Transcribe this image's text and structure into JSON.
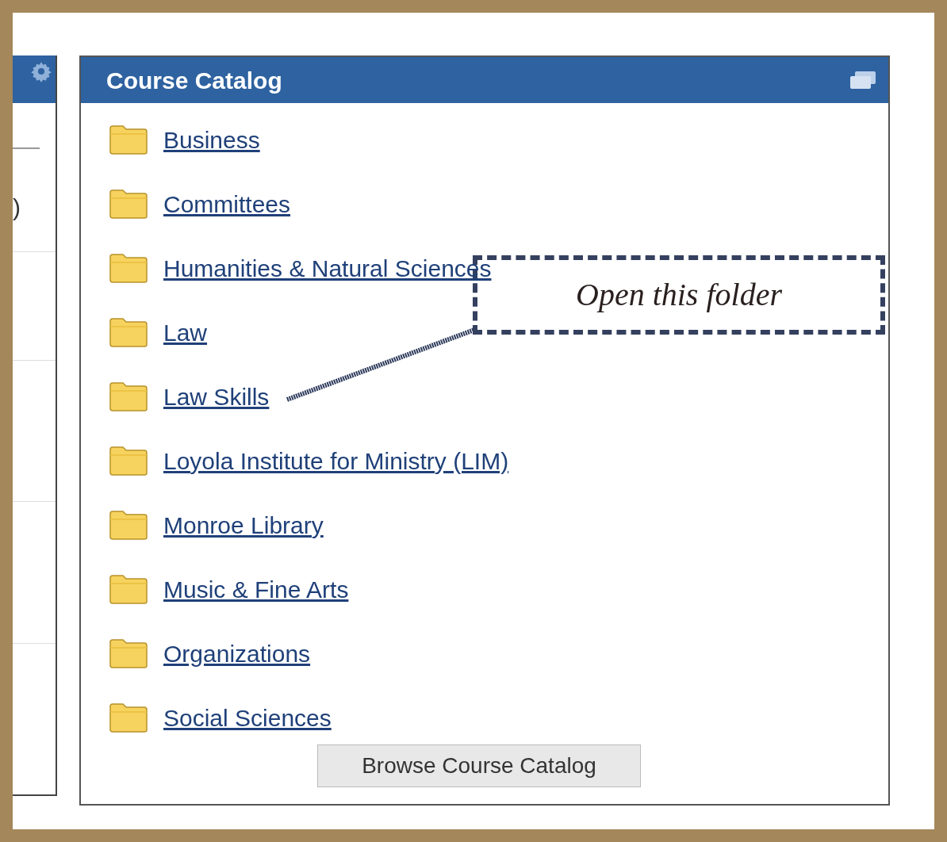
{
  "left_panel": {
    "fragment": ")"
  },
  "course_catalog": {
    "title": "Course Catalog",
    "folders": [
      "Business",
      "Committees",
      "Humanities & Natural Sciences",
      "Law",
      "Law Skills",
      "Loyola Institute for Ministry (LIM)",
      "Monroe Library",
      "Music & Fine Arts",
      "Organizations",
      "Social Sciences"
    ],
    "button": "Browse Course Catalog"
  },
  "callout": {
    "text": "Open this folder"
  }
}
